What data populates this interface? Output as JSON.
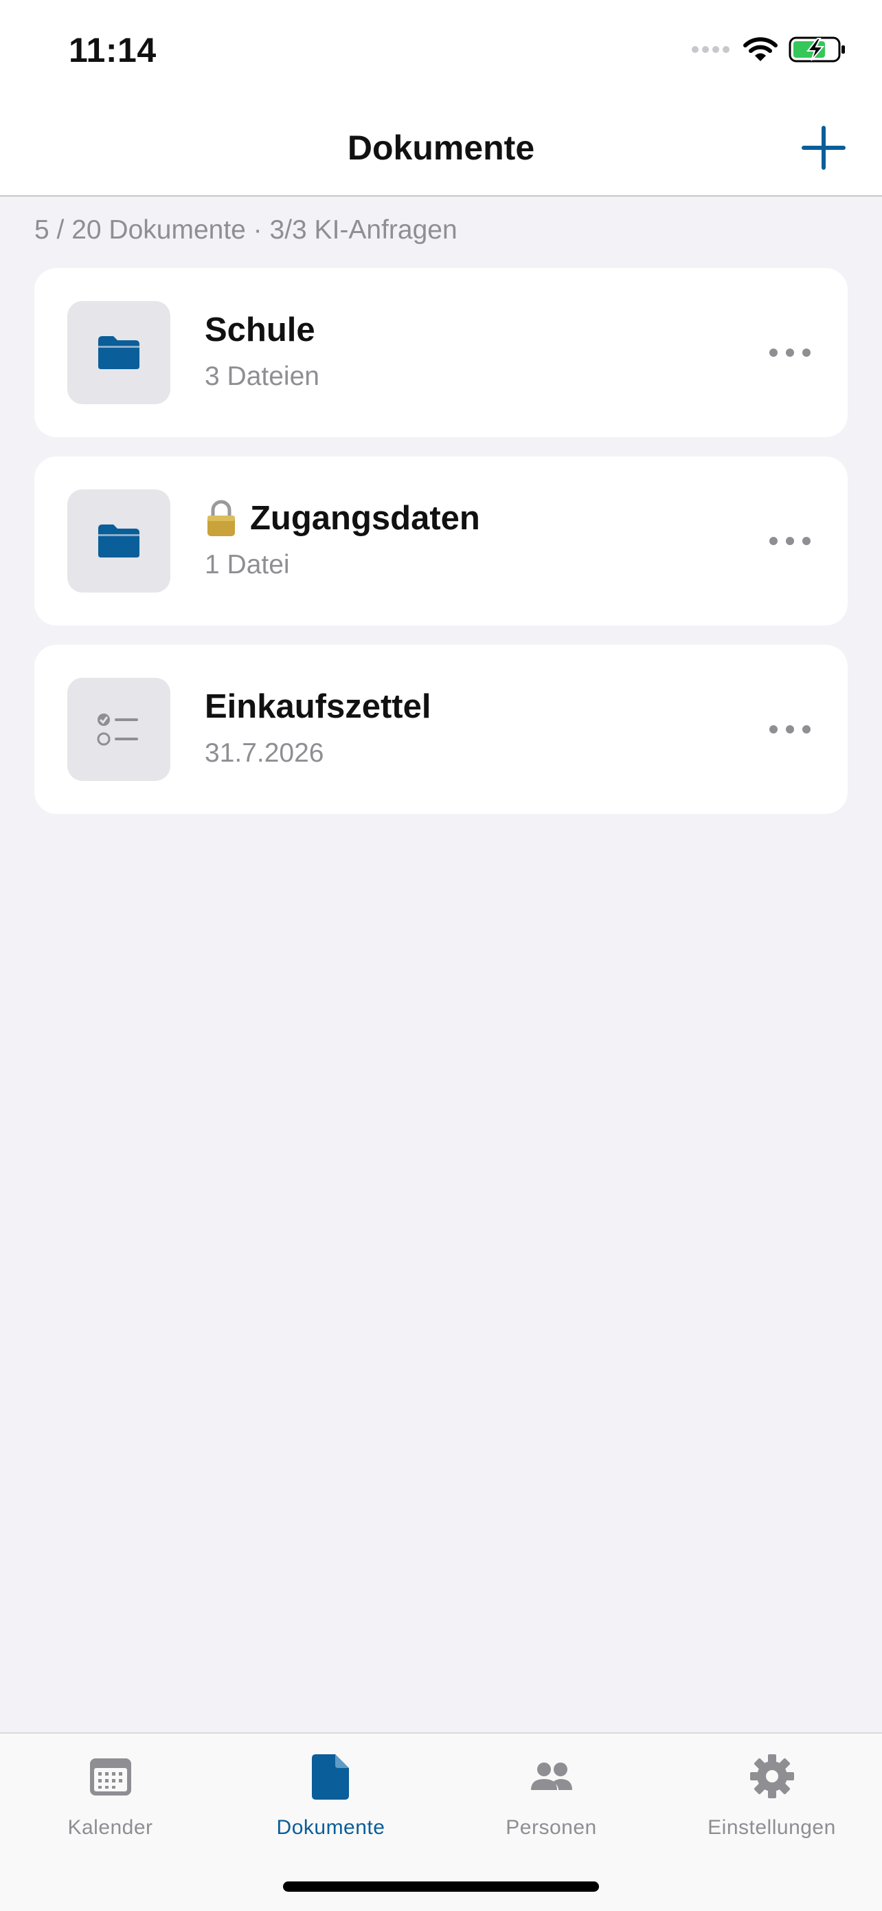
{
  "status_bar": {
    "time": "11:14"
  },
  "header": {
    "title": "Dokumente",
    "add_icon": "plus-icon"
  },
  "summary": "5 / 20 Dokumente · 3/3 KI-Anfragen",
  "items": [
    {
      "title": "Schule",
      "subtitle": "3 Dateien",
      "icon": "folder-icon",
      "locked": false
    },
    {
      "title": "Zugangsdaten",
      "subtitle": "1 Datei",
      "icon": "folder-icon",
      "locked": true
    },
    {
      "title": "Einkaufszettel",
      "subtitle": "31.7.2026",
      "icon": "checklist-icon",
      "locked": false
    }
  ],
  "tabs": [
    {
      "label": "Kalender",
      "icon": "calendar-icon",
      "active": false
    },
    {
      "label": "Dokumente",
      "icon": "document-icon",
      "active": true
    },
    {
      "label": "Personen",
      "icon": "people-icon",
      "active": false
    },
    {
      "label": "Einstellungen",
      "icon": "gear-icon",
      "active": false
    }
  ],
  "colors": {
    "accent": "#0a5e99",
    "background": "#f2f2f7",
    "card": "#ffffff",
    "secondary_text": "#8e8e93",
    "battery": "#34c759"
  }
}
